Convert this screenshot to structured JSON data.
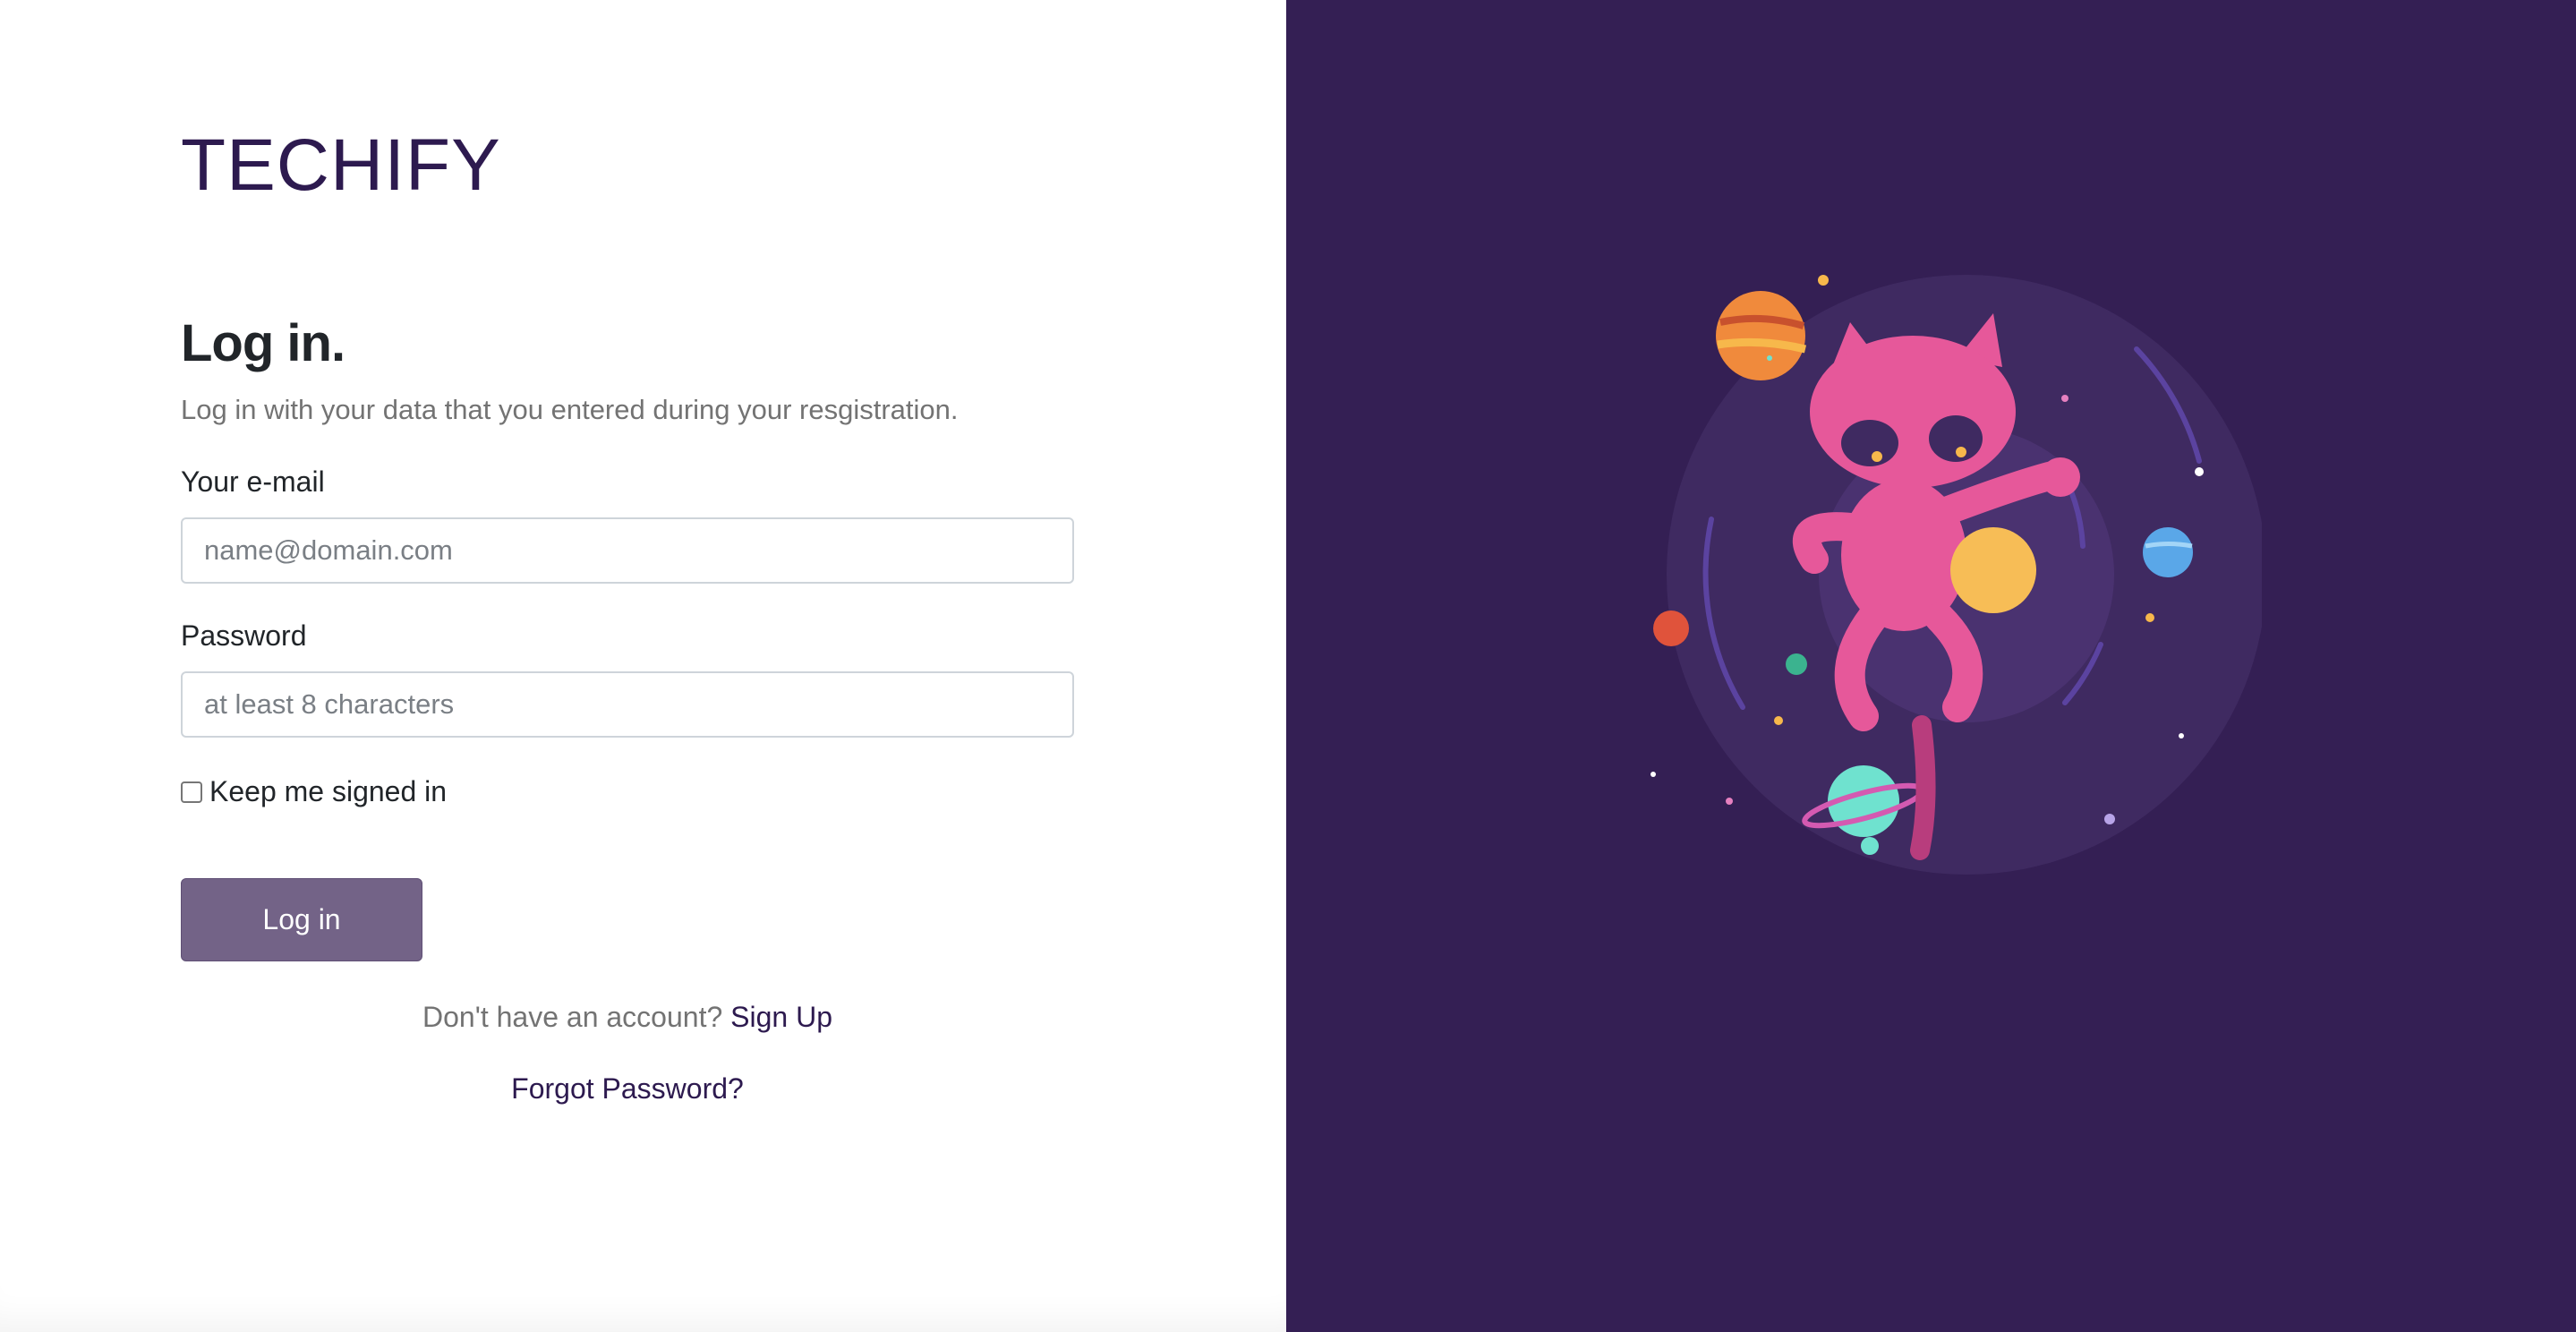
{
  "brand": {
    "name": "TECHIFY"
  },
  "login": {
    "title": "Log in.",
    "subtitle": "Log in with your data that you entered during your resgistration.",
    "email_label": "Your e-mail",
    "email_placeholder": "name@domain.com",
    "email_value": "",
    "password_label": "Password",
    "password_placeholder": "at least 8 characters",
    "password_value": "",
    "remember_label": "Keep me signed in",
    "remember_checked": false,
    "submit_label": "Log in",
    "signup_prompt": "Don't have an account?",
    "signup_link": "Sign Up",
    "forgot_link": "Forgot Password?"
  },
  "illustration": {
    "subject": "space-cat-icon",
    "background_color": "#341f54",
    "accent_colors": [
      "#e6589a",
      "#f7b84b",
      "#6fe2cf",
      "#5aa7e8",
      "#f08a3c"
    ]
  }
}
